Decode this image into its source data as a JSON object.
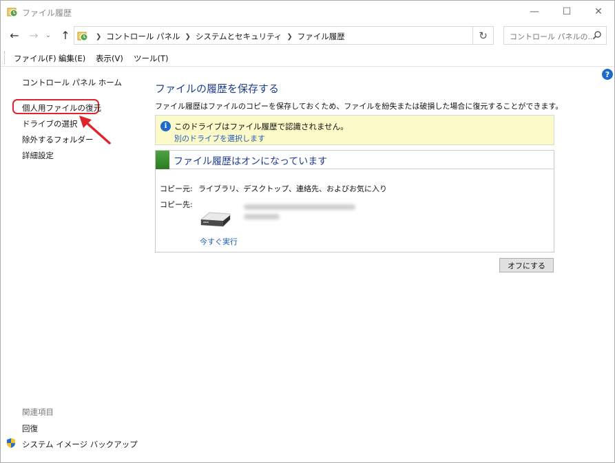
{
  "window": {
    "title": "ファイル履歴",
    "controls": {
      "minimize_icon": "minimize-icon",
      "maximize_icon": "maximize-icon",
      "close_icon": "close-icon"
    }
  },
  "address": {
    "breadcrumbs": [
      "コントロール パネル",
      "システムとセキュリティ",
      "ファイル履歴"
    ],
    "search_placeholder": "コントロール パネルの..."
  },
  "menu": [
    "ファイル(F)",
    "編集(E)",
    "表示(V)",
    "ツール(T)"
  ],
  "sidebar": {
    "home": "コントロール パネル ホーム",
    "links": [
      "個人用ファイルの復元",
      "ドライブの選択",
      "除外するフォルダー",
      "詳細設定"
    ],
    "related_heading": "関連項目",
    "related_links": [
      "回復",
      "システム イメージ バックアップ"
    ]
  },
  "main": {
    "title": "ファイルの履歴を保存する",
    "description": "ファイル履歴はファイルのコピーを保存しておくため、ファイルを紛失または破損した場合に復元することができます。",
    "warning": {
      "text": "このドライブはファイル履歴で認識されません。",
      "link": "別のドライブを選択します"
    },
    "status": {
      "title": "ファイル履歴はオンになっています",
      "copy_from_label": "コピー元:",
      "copy_from_value": "ライブラリ、デスクトップ、連絡先、およびお気に入り",
      "copy_to_label": "コピー先:",
      "run_now": "今すぐ実行"
    },
    "off_button": "オフにする"
  },
  "colors": {
    "title_blue": "#1e3d8f",
    "link_blue": "#1f5bb8",
    "warning_bg": "#fcfac8",
    "status_green": "#3d8f34",
    "highlight_red": "#e0242b"
  }
}
